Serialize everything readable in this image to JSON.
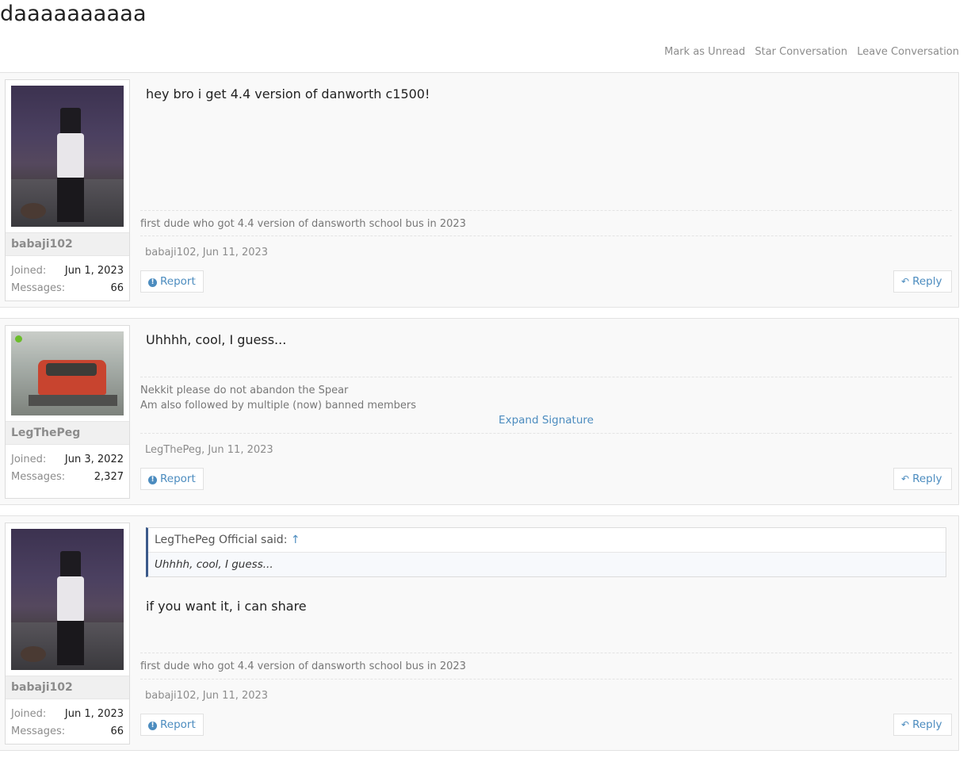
{
  "conversation": {
    "title": "daaaaaaaaaa",
    "actions": [
      "Mark as Unread",
      "Star Conversation",
      "Leave Conversation"
    ]
  },
  "labels": {
    "joined": "Joined:",
    "messages": "Messages:",
    "report": "Report",
    "reply": "Reply",
    "expand_signature": "Expand Signature"
  },
  "messages": [
    {
      "username": "babaji102",
      "joined": "Jun 1, 2023",
      "message_count": "66",
      "text": "hey bro i get 4.4 version of danworth c1500!",
      "signature": "first dude who got 4.4 version of dansworth school bus in 2023",
      "author_date": "babaji102, Jun 11, 2023"
    },
    {
      "username": "LegThePeg",
      "joined": "Jun 3, 2022",
      "message_count": "2,327",
      "online": true,
      "text": "Uhhhh, cool, I guess...",
      "signature_lines": [
        "Nekkit please do not abandon the Spear",
        "Am also followed by multiple (now) banned members"
      ],
      "author_date": "LegThePeg, Jun 11, 2023"
    },
    {
      "username": "babaji102",
      "joined": "Jun 1, 2023",
      "message_count": "66",
      "quote": {
        "attribution": "LegThePeg Official said:",
        "arrow": "↑",
        "text": "Uhhhh, cool, I guess..."
      },
      "text": "if you want it, i can share",
      "signature": "first dude who got 4.4 version of dansworth school bus in 2023",
      "author_date": "babaji102, Jun 11, 2023"
    }
  ],
  "icons": [
    "exclamation-circle-icon",
    "reply-arrow-icon",
    "up-arrow-icon"
  ],
  "colors": {
    "link": "#4c8cbf",
    "online": "#6bbd2b",
    "quote_border": "#3c5a8a"
  }
}
